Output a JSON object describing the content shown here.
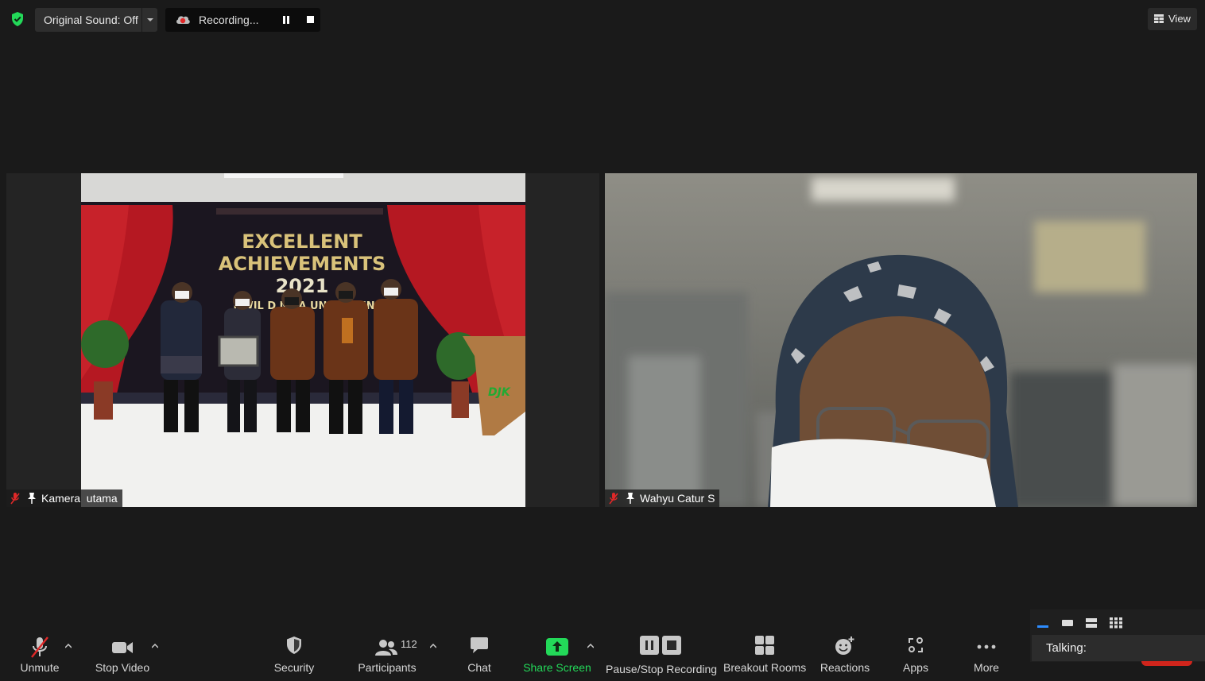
{
  "top_bar": {
    "original_sound_label": "Original Sound: Off",
    "recording_label": "Recording...",
    "view_label": "View"
  },
  "tiles": [
    {
      "name": "Kamera  utama"
    },
    {
      "name": "Wahyu Catur S"
    }
  ],
  "banner": {
    "line1": "EXCELLENT",
    "line2": "ACHIEVEMENTS",
    "line3": "2021",
    "line4": "NWIL D  N LA   UNG D   BEN   LU",
    "podium": "DJK"
  },
  "toolbar": {
    "unmute": "Unmute",
    "stop_video": "Stop Video",
    "security": "Security",
    "participants": "Participants",
    "participants_count": "112",
    "chat": "Chat",
    "share_screen": "Share Screen",
    "pause_stop_recording": "Pause/Stop Recording",
    "breakout_rooms": "Breakout Rooms",
    "reactions": "Reactions",
    "apps": "Apps",
    "more": "More"
  },
  "panel": {
    "talking_label": "Talking:"
  },
  "colors": {
    "background": "#1a1a1a",
    "share_green": "#23d959",
    "mute_red": "#e02828",
    "shield_green": "#23d959"
  }
}
